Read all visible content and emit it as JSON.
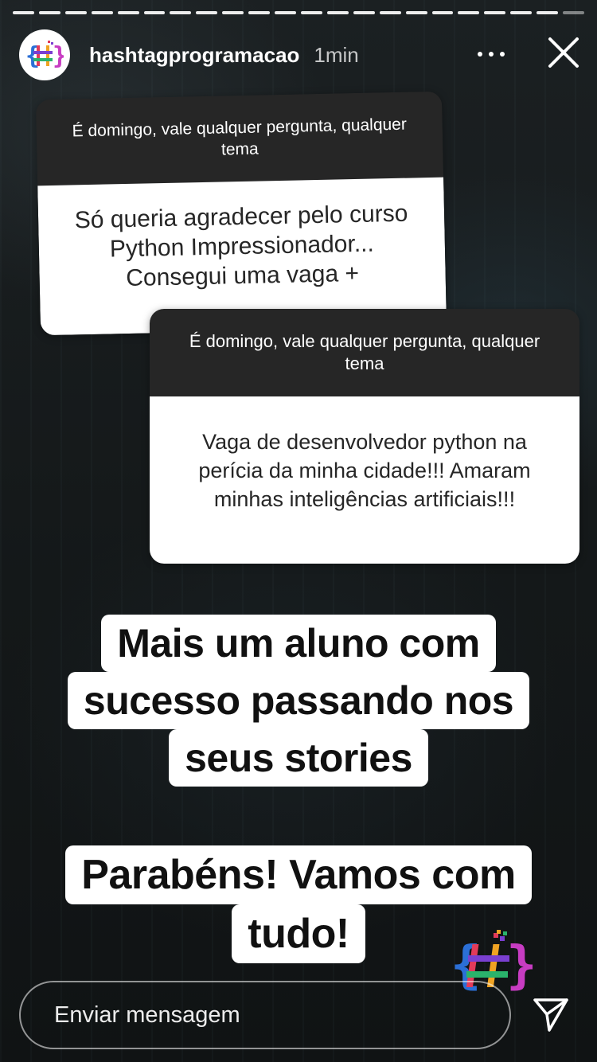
{
  "story": {
    "progress_segments_total": 22,
    "progress_segments_done": 21
  },
  "header": {
    "username": "hashtagprogramacao",
    "time": "1min",
    "avatar_icon": "hashtag-logo-icon",
    "more_icon": "more-dots-icon",
    "close_icon": "close-icon"
  },
  "cards": [
    {
      "question": "É domingo, vale qualquer pergunta, qualquer tema",
      "answer": "Só queria agradecer pelo curso Python Impressionador... Consegui uma vaga +"
    },
    {
      "question": "É domingo, vale qualquer pergunta, qualquer tema",
      "answer": "Vaga de desenvolvedor python na perícia da minha cidade!!! Amaram minhas inteligências artificiais!!!"
    }
  ],
  "captions": {
    "first": [
      "Mais um aluno com",
      "sucesso passando nos",
      "seus stories"
    ],
    "second": [
      "Parabéns! Vamos com",
      "tudo!"
    ]
  },
  "footer": {
    "placeholder": "Enviar mensagem",
    "send_icon": "send-icon"
  },
  "colors": {
    "background": "#161a1c",
    "card_question": "#262626",
    "card_answer": "#ffffff",
    "caption_bg": "#ffffff",
    "caption_text": "#111111"
  }
}
